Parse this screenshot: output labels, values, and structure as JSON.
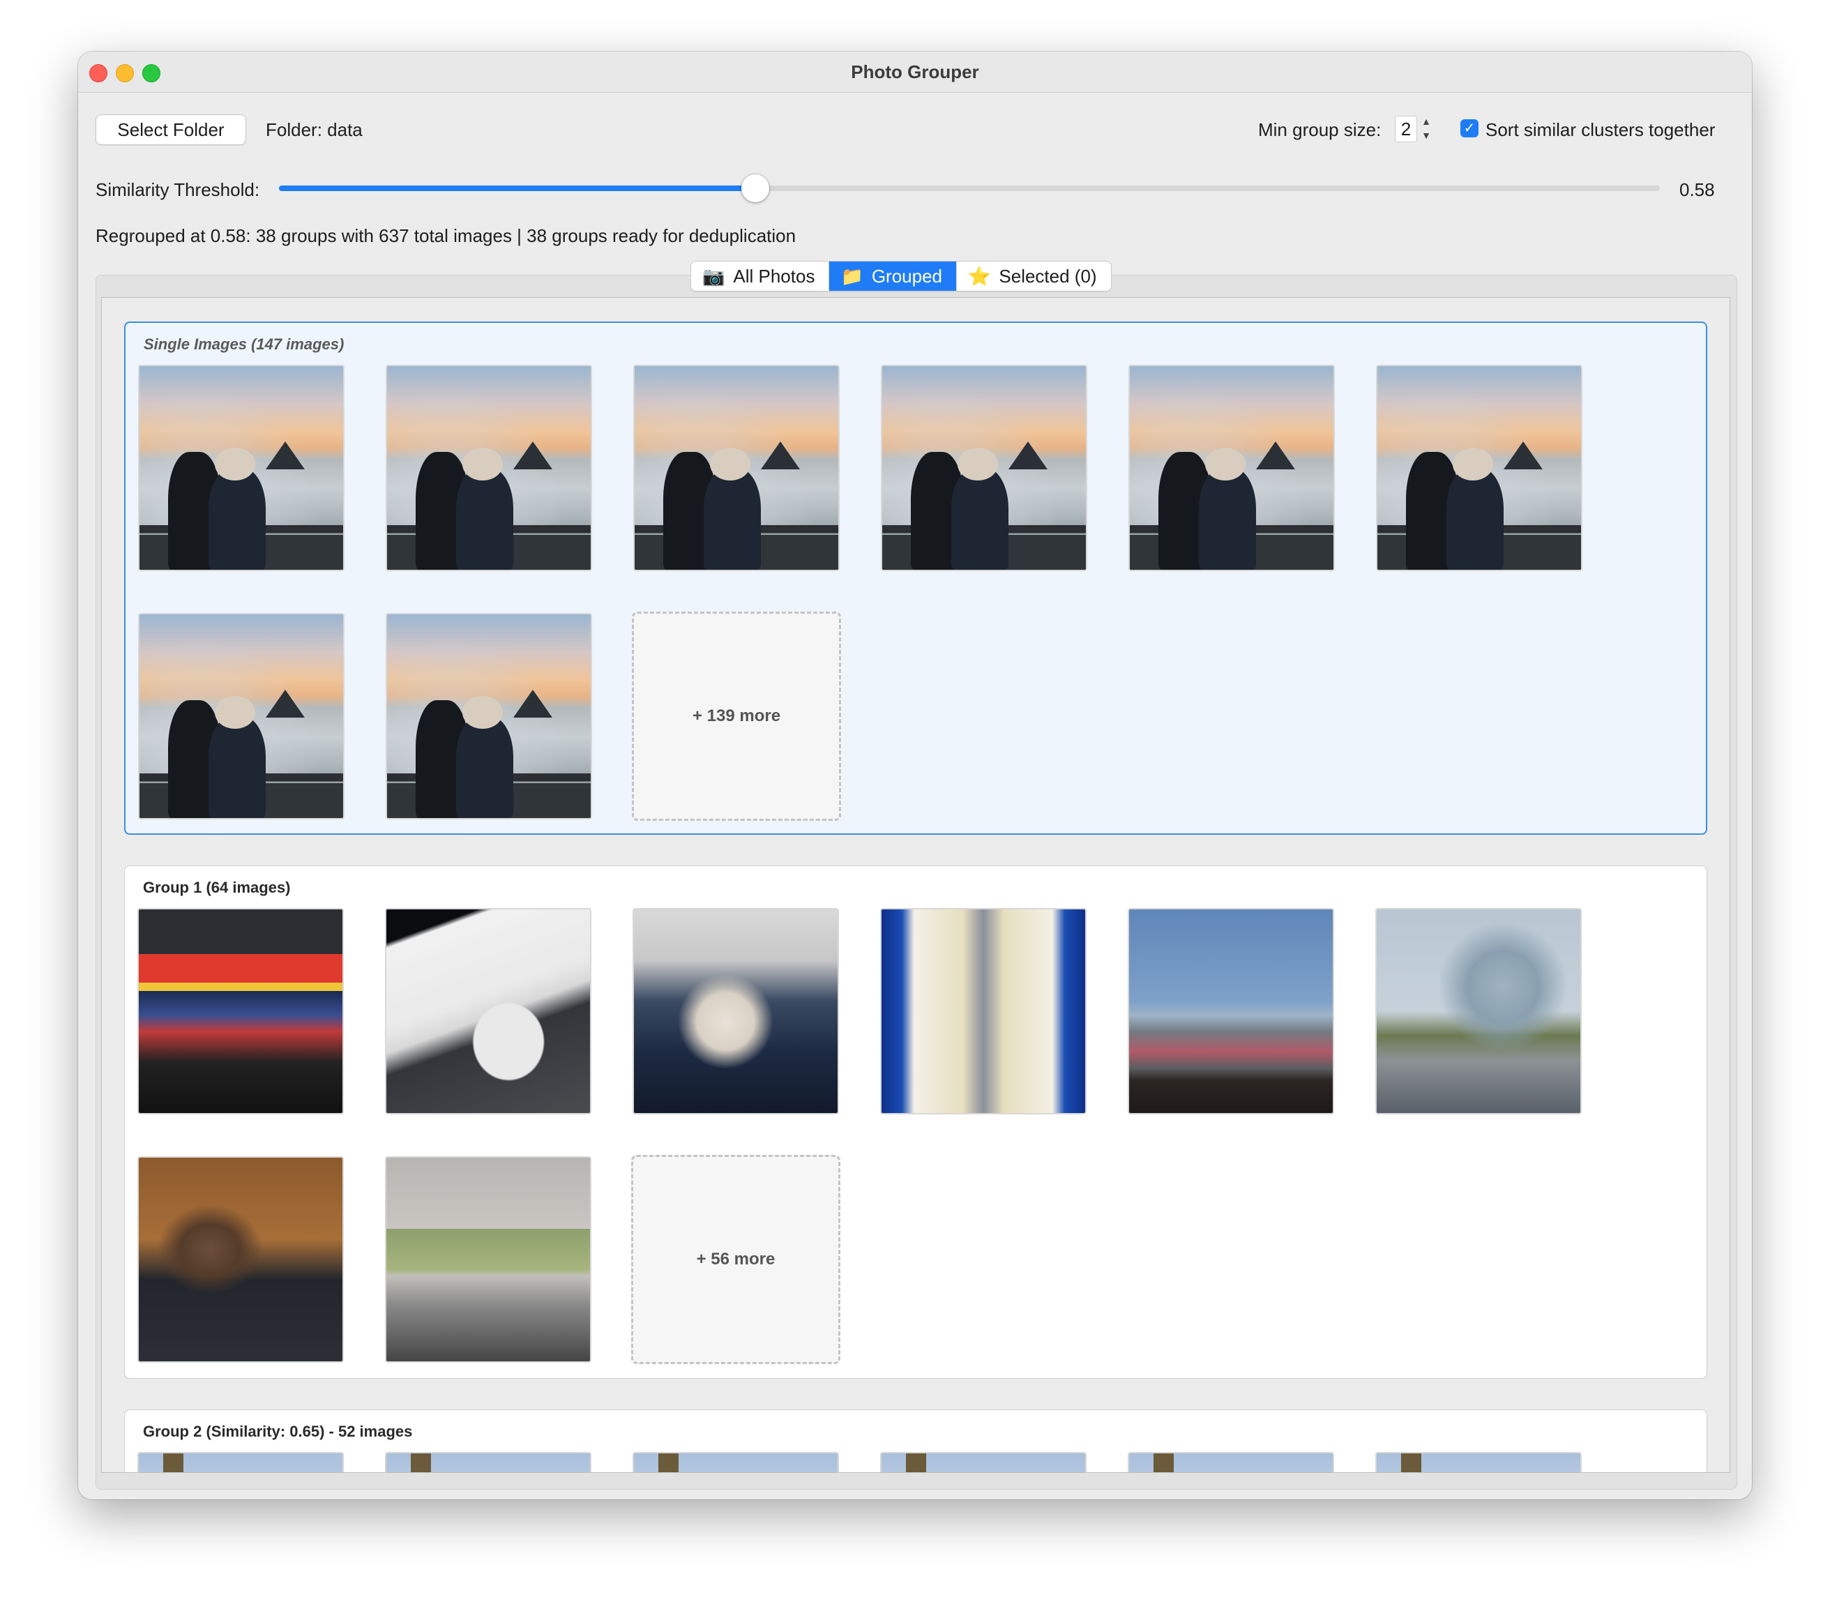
{
  "window": {
    "title": "Photo Grouper"
  },
  "toolbar": {
    "select_folder_label": "Select Folder",
    "folder_label": "Folder: data",
    "min_group_size_label": "Min group size:",
    "min_group_size_value": "2",
    "sort_checkbox_label": "Sort similar clusters together",
    "sort_checked": true
  },
  "threshold": {
    "label": "Similarity Threshold:",
    "value": 0.58,
    "value_text": "0.58",
    "min": 0,
    "max": 1
  },
  "status_text": "Regrouped at 0.58: 38 groups with 637 total images | 38 groups ready for deduplication",
  "tabs": [
    {
      "icon": "camera-icon",
      "glyph": "📷",
      "label": "All Photos",
      "active": false
    },
    {
      "icon": "folder-icon",
      "glyph": "📁",
      "label": "Grouped",
      "active": true
    },
    {
      "icon": "star-icon",
      "glyph": "⭐",
      "label": "Selected (0)",
      "active": false
    }
  ],
  "groups": [
    {
      "title": "Single Images (147 images)",
      "kind": "single",
      "thumbnails": [
        "sunset",
        "sunset",
        "sunset",
        "sunset",
        "sunset",
        "sunset",
        "sunset",
        "sunset"
      ],
      "more_label": "+ 139 more"
    },
    {
      "title": "Group 1 (64 images)",
      "kind": "group",
      "thumbnails": [
        "airport",
        "plane",
        "seat",
        "hall",
        "window",
        "building",
        "selfie",
        "bedroom"
      ],
      "more_label": "+ 56 more"
    },
    {
      "title": "Group 2 (Similarity: 0.65) - 52 images",
      "kind": "group",
      "thumbnails": [
        "sky",
        "sky",
        "sky",
        "sky",
        "sky",
        "sky"
      ],
      "more_label": ""
    }
  ],
  "colors": {
    "accent": "#1f7cf6",
    "single_group_bg": "#eef5fc",
    "single_group_border": "#3b8ee0"
  }
}
